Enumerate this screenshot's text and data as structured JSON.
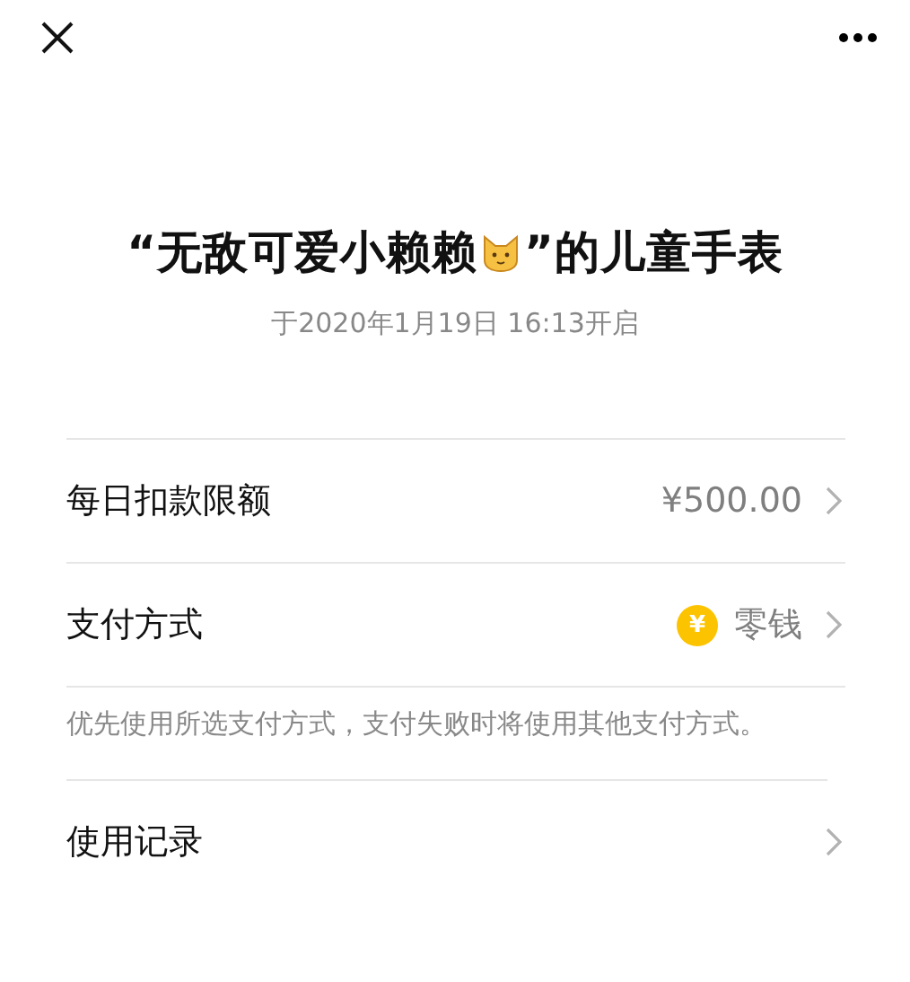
{
  "title": {
    "before": "“无敌可爱小赖赖",
    "after": "”的儿童手表"
  },
  "subtitle": "于2020年1月19日 16:13开启",
  "rows": [
    {
      "label": "每日扣款限额",
      "value": "¥500.00",
      "kind": "amount"
    },
    {
      "label": "支付方式",
      "value": "零钱",
      "badge": "¥",
      "kind": "method"
    }
  ],
  "note": "优先使用所选支付方式，支付失败时将使用其他支付方式。",
  "records": {
    "label": "使用记录"
  }
}
